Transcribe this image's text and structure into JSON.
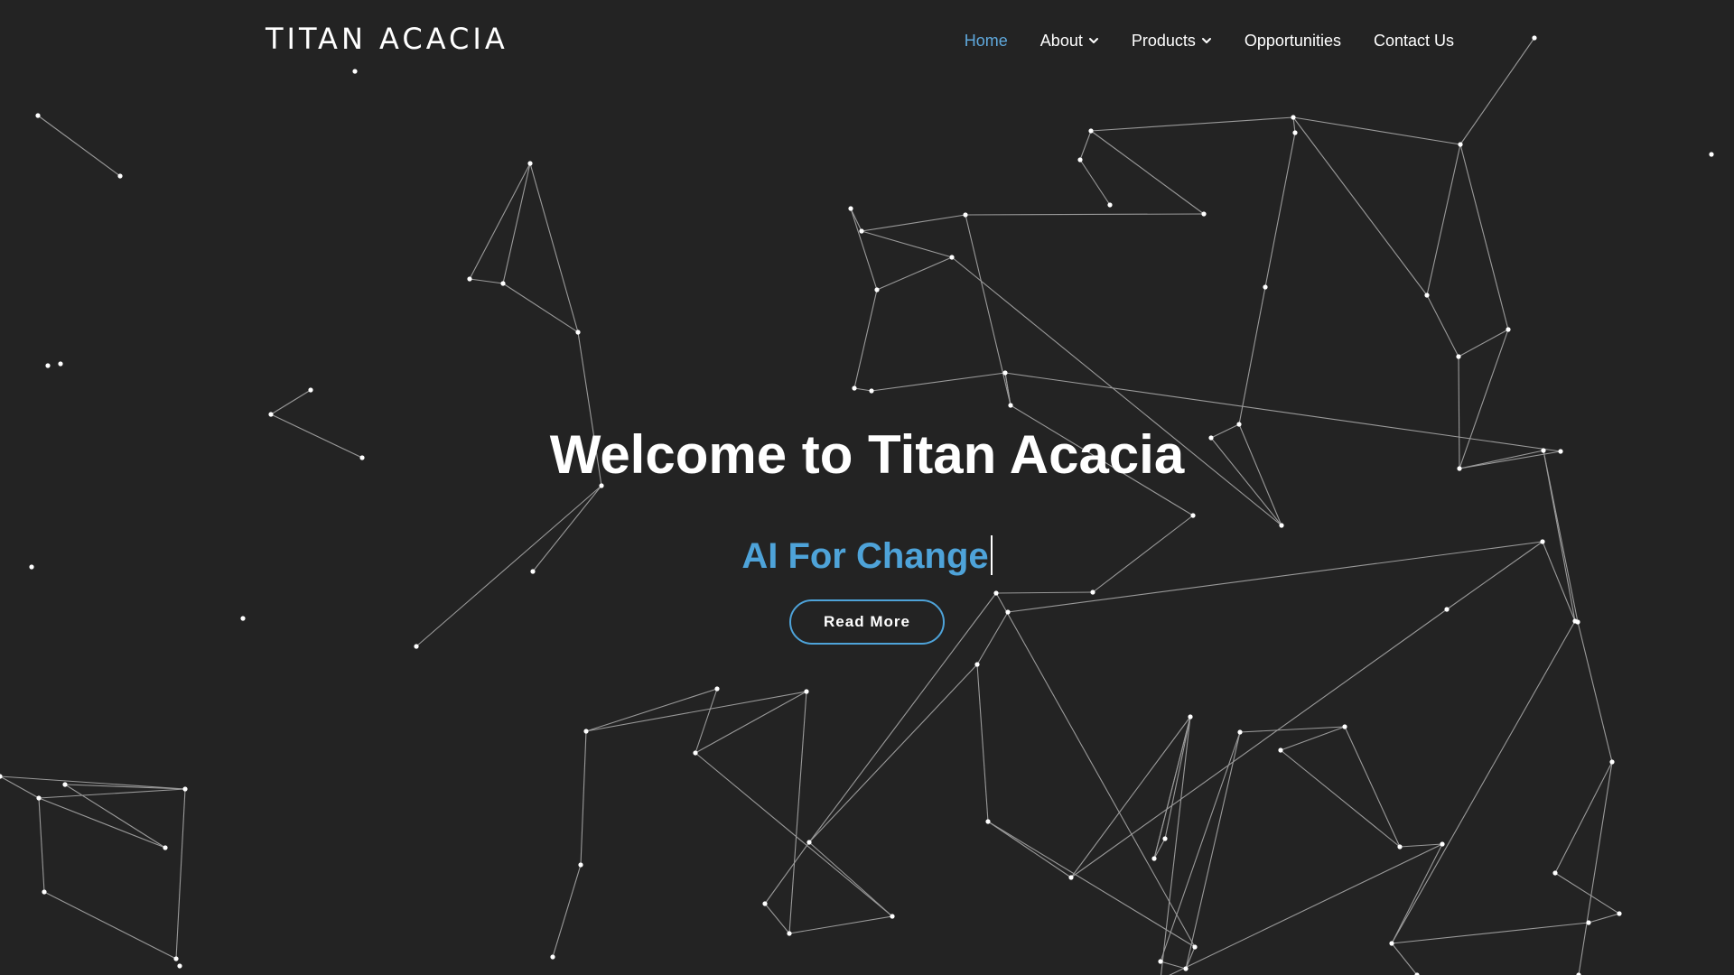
{
  "brand": {
    "name": "TITAN ACACIA"
  },
  "nav": {
    "items": [
      {
        "label": "Home",
        "active": true,
        "has_dropdown": false
      },
      {
        "label": "About",
        "active": false,
        "has_dropdown": true,
        "icon": "chevron-down-icon"
      },
      {
        "label": "Products",
        "active": false,
        "has_dropdown": true,
        "icon": "chevron-down-icon"
      },
      {
        "label": "Opportunities",
        "active": false,
        "has_dropdown": false
      },
      {
        "label": "Contact Us",
        "active": false,
        "has_dropdown": false
      }
    ]
  },
  "hero": {
    "title": "Welcome to Titan Acacia",
    "typed_text": "AI For Change",
    "cta_label": "Read More"
  },
  "colors": {
    "background": "#232323",
    "accent": "#4ea3d9",
    "nav_active": "#5fa8dc",
    "text": "#ffffff",
    "network_line": "#9a9a9a",
    "network_node": "#ffffff"
  }
}
